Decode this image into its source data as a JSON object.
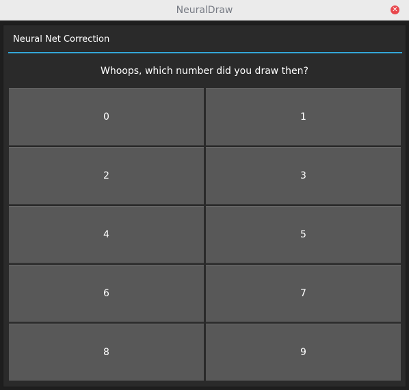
{
  "window": {
    "title": "NeuralDraw",
    "close_glyph": "✕"
  },
  "dialog": {
    "title": "Neural Net Correction",
    "prompt": "Whoops, which number did you draw then?",
    "accent_color": "#33a6d8"
  },
  "digits": [
    "0",
    "1",
    "2",
    "3",
    "4",
    "5",
    "6",
    "7",
    "8",
    "9"
  ]
}
